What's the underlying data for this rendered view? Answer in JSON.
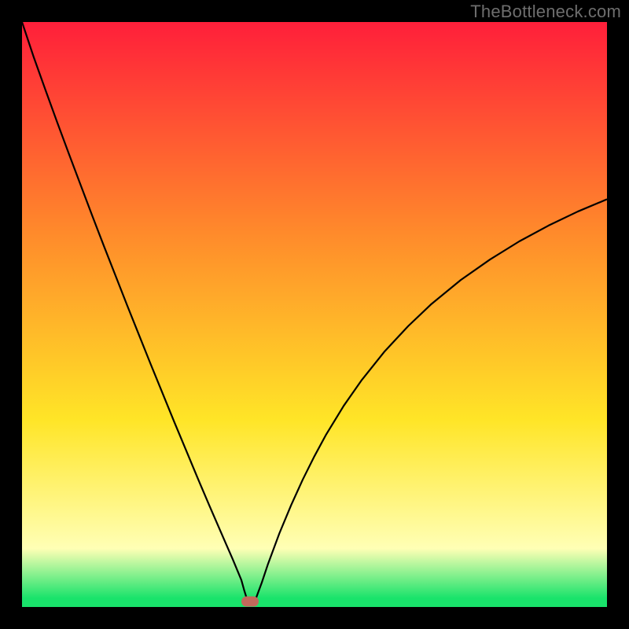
{
  "watermark": "TheBottleneck.com",
  "colors": {
    "frame": "#000000",
    "gradient_top": "#ff1f3a",
    "gradient_orange": "#ff8a2b",
    "gradient_yellow": "#ffe527",
    "gradient_paleyellow": "#ffffb5",
    "gradient_green": "#19e36b",
    "curve": "#000000",
    "marker": "#c1695b"
  },
  "chart_data": {
    "type": "line",
    "title": "",
    "xlabel": "",
    "ylabel": "",
    "xlim": [
      0,
      100
    ],
    "ylim": [
      0,
      100
    ],
    "notch_x": 38,
    "marker": {
      "x": 39,
      "y": 1
    },
    "series": [
      {
        "name": "bottleneck-curve",
        "x": [
          0,
          2,
          4,
          6,
          8,
          10,
          12,
          14,
          16,
          18,
          20,
          22,
          24,
          26,
          28,
          30,
          32,
          33,
          34,
          35,
          36,
          37,
          37.5,
          38,
          38.5,
          39,
          39.5,
          40,
          41,
          42,
          44,
          46,
          48,
          50,
          52,
          55,
          58,
          62,
          66,
          70,
          75,
          80,
          85,
          90,
          95,
          100
        ],
        "y": [
          100,
          94,
          88.4,
          82.9,
          77.5,
          72.2,
          66.9,
          61.7,
          56.6,
          51.5,
          46.5,
          41.5,
          36.6,
          31.7,
          26.9,
          22.1,
          17.4,
          15.1,
          12.8,
          10.5,
          8.2,
          5.8,
          4.6,
          2.8,
          1.2,
          0.3,
          0.4,
          1.5,
          4.2,
          7.2,
          12.6,
          17.4,
          21.8,
          25.8,
          29.5,
          34.4,
          38.7,
          43.7,
          48,
          51.8,
          55.9,
          59.4,
          62.5,
          65.2,
          67.6,
          69.7
        ]
      }
    ]
  }
}
